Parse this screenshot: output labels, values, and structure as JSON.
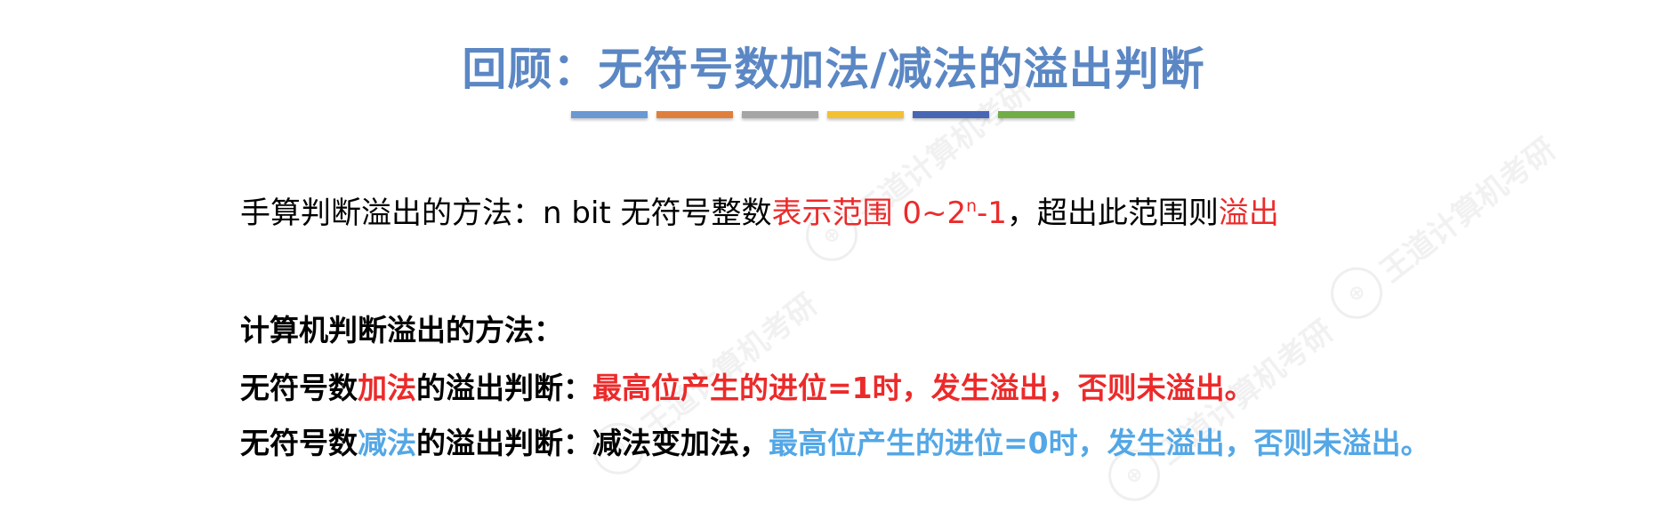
{
  "title": "回顾：无符号数加法/减法的溢出判断",
  "colors": {
    "title": "#5b87c4",
    "red": "#ec2a2a",
    "blue": "#53a7e6",
    "bars": [
      "#6a98d3",
      "#e07f3c",
      "#a5a5a5",
      "#f4c030",
      "#4767b5",
      "#70ad47"
    ]
  },
  "line1": {
    "prefix": "手算判断溢出的方法：n bit 无符号整数",
    "red_part": "表示范围 0~2",
    "superscript": "n",
    "red_tail": "-1",
    "middle": "，超出此范围则",
    "red_end": "溢出"
  },
  "line2": {
    "text": "计算机判断溢出的方法："
  },
  "line3": {
    "prefix": "无符号数",
    "highlight": "加法",
    "middle": "的溢出判断：",
    "red_rest": "最高位产生的进位=1时，发生溢出，否则未溢出。"
  },
  "line4": {
    "prefix": "无符号数",
    "highlight": "减法",
    "middle": "的溢出判断：减法变加法，",
    "blue_rest": "最高位产生的进位=0时，发生溢出，否则未溢出。"
  },
  "watermark": {
    "text": "王道计算机考研",
    "logo_glyph": "⊕"
  }
}
